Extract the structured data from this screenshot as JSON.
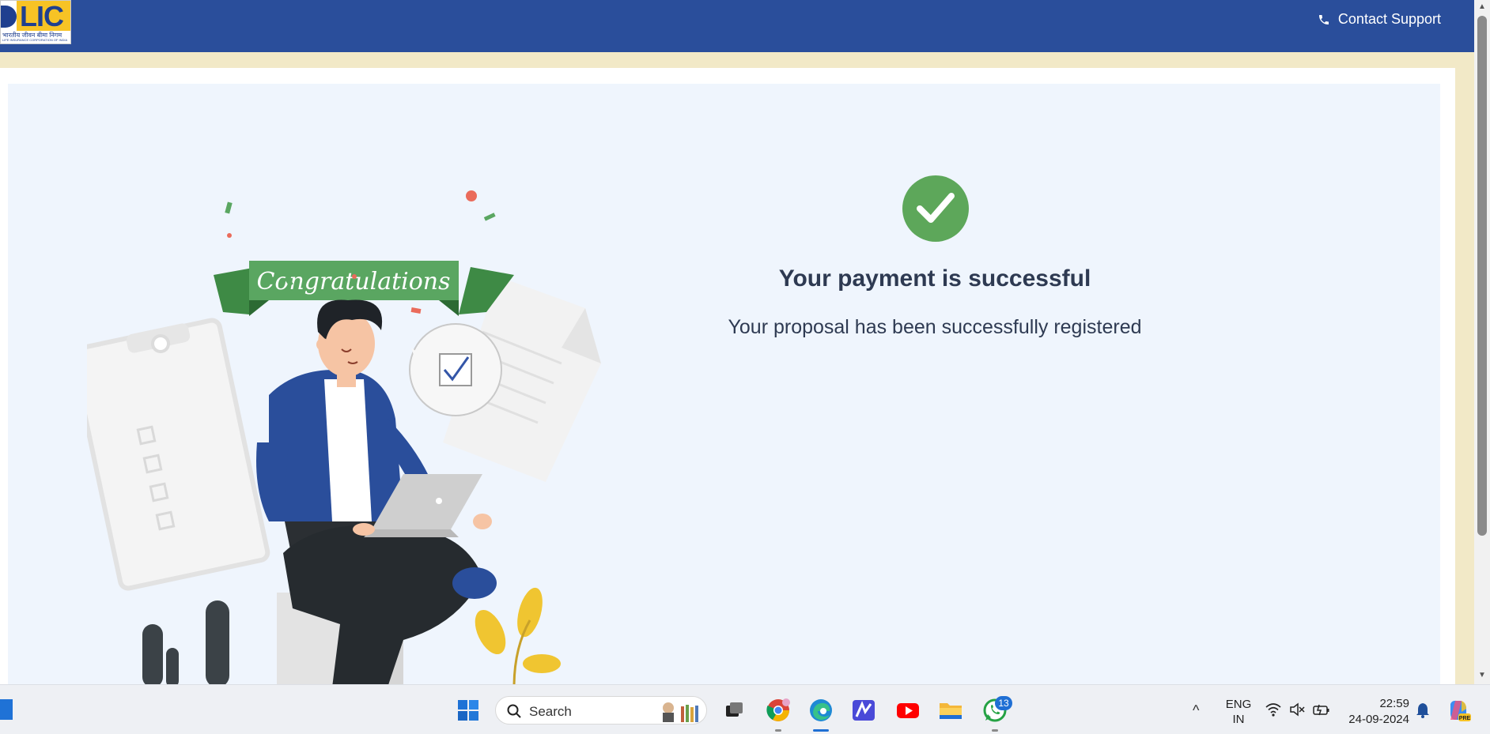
{
  "header": {
    "logo_text": "LIC",
    "logo_hindi": "भारतीय जीवन बीमा निगम",
    "logo_english": "LIFE INSURANCE CORPORATION OF INDIA",
    "contact_label": "Contact Support",
    "contact_icon": "phone-icon"
  },
  "illustration": {
    "banner_text": "Congratulations"
  },
  "success": {
    "icon": "check-circle-icon",
    "title": "Your payment is successful",
    "subtitle": "Your proposal has been successfully registered"
  },
  "colors": {
    "header_bg": "#2a4e9b",
    "card_bg": "#eff5fd",
    "success_green": "#5da75a",
    "text_dark": "#2e3a52",
    "beige": "#f2e9c7"
  },
  "taskbar": {
    "search_placeholder": "Search",
    "apps": [
      "task-view",
      "chrome",
      "edge",
      "mail",
      "youtube",
      "file-explorer",
      "whatsapp"
    ],
    "whatsapp_badge": "13",
    "language_top": "ENG",
    "language_bottom": "IN",
    "time": "22:59",
    "date": "24-09-2024"
  }
}
